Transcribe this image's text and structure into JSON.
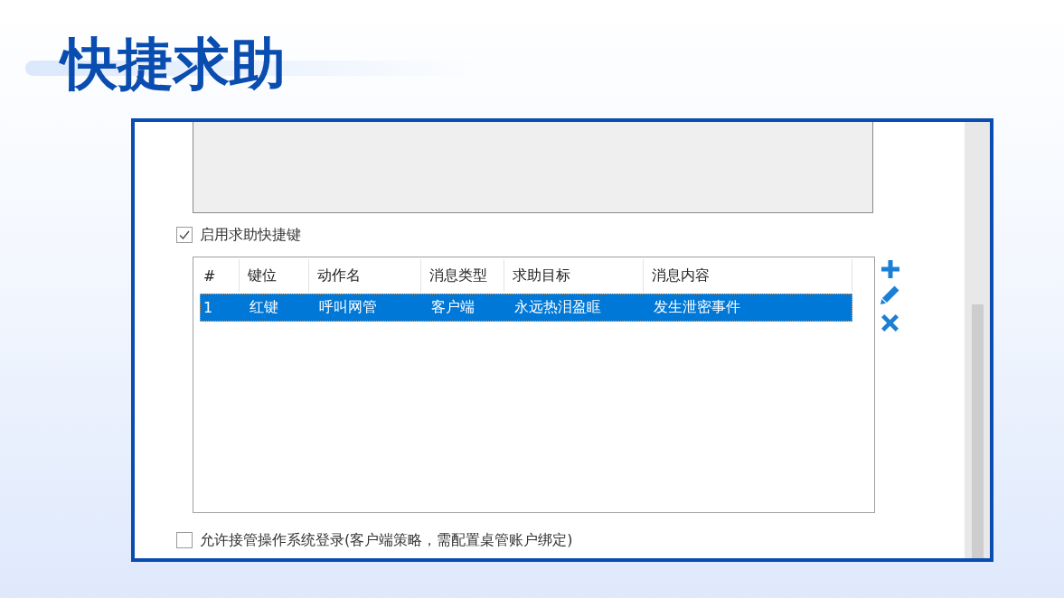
{
  "title": "快捷求助",
  "hotkey_option": {
    "label": "启用求助快捷键",
    "checked": true
  },
  "hotkey_table": {
    "columns": [
      "#",
      "键位",
      "动作名",
      "消息类型",
      "求助目标",
      "消息内容"
    ],
    "rows": [
      {
        "cells": [
          "1",
          "红键",
          "呼叫网管",
          "客户端",
          "永远热泪盈眶",
          "发生泄密事件"
        ],
        "selected": true
      }
    ]
  },
  "login_option": {
    "label": "允许接管操作系统登录(客户端策略，需配置桌管账户绑定)",
    "checked": false
  }
}
